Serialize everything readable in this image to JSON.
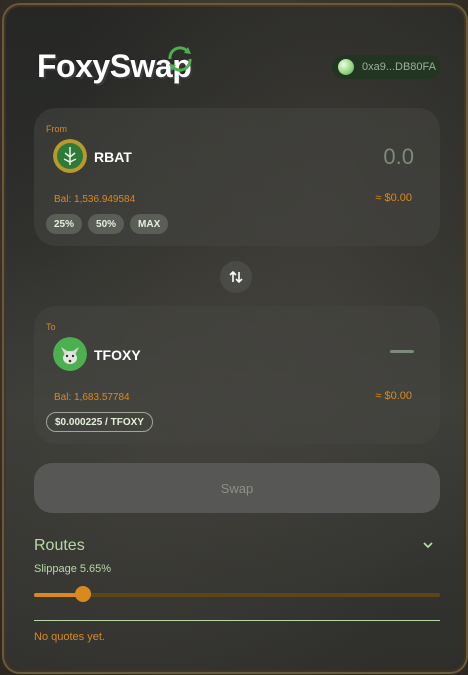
{
  "header": {
    "app_name": "FoxySwap",
    "wallet_address": "0xa9...DB80FA"
  },
  "from": {
    "label": "From",
    "token": "RBAT",
    "amount": "0.0",
    "balance": "Bal: 1,536.949584",
    "usd_value": "≈ $0.00",
    "quick_amounts": [
      "25%",
      "50%",
      "MAX"
    ]
  },
  "to": {
    "label": "To",
    "token": "TFOXY",
    "amount_placeholder": "—",
    "balance": "Bal: 1,683.57784",
    "usd_value": "≈ $0.00",
    "price": "$0.000225 / TFOXY"
  },
  "swap_button": {
    "label": "Swap"
  },
  "routes": {
    "title": "Routes",
    "slippage": "Slippage 5.65%",
    "slippage_slider_fraction": 0.12,
    "empty_message": "No quotes yet."
  },
  "colors": {
    "accent": "#d98a1f",
    "green_text": "#b7d9a6"
  }
}
